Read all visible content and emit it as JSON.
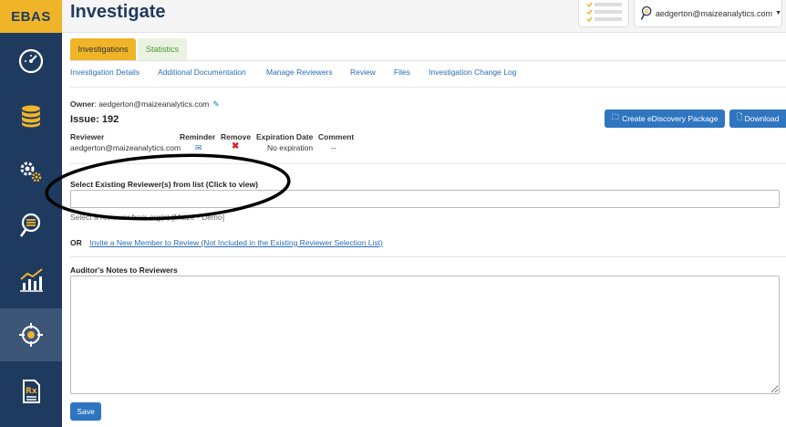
{
  "brand": "EBAS",
  "header": {
    "title": "Investigate",
    "user": "aedgerton@maizeanalytics.com"
  },
  "sidebar": {
    "items": [
      {
        "icon": "gauge-icon"
      },
      {
        "icon": "database-icon"
      },
      {
        "icon": "gears-icon"
      },
      {
        "icon": "investigate-icon"
      },
      {
        "icon": "chart-icon"
      },
      {
        "icon": "target-icon",
        "active": true
      },
      {
        "icon": "prescription-icon"
      }
    ]
  },
  "tabs": [
    "Investigations",
    "Statistics"
  ],
  "subnav": [
    "Investigation Details",
    "Additional Documentation",
    "Manage Reviewers",
    "Review",
    "Files",
    "Investigation Change Log"
  ],
  "owner": {
    "label": "Owner",
    "value": "aedgerton@maizeanalytics.com"
  },
  "issue": "Issue: 192",
  "buttons": {
    "ediscovery": "Create eDiscovery Package",
    "download": "Download",
    "save": "Save"
  },
  "reviewer_table": {
    "headers": [
      "Reviewer",
      "Reminder",
      "Remove",
      "Expiration Date",
      "Comment"
    ],
    "rows": [
      {
        "reviewer": "aedgerton@maizeanalytics.com",
        "expiration": "No expiration",
        "comment": "--"
      }
    ]
  },
  "select_reviewers": {
    "label": "Select Existing Reviewer(s) from list (Click to view)",
    "value": "",
    "help": "Select a reviewer from org(s) [Maize - Demo]"
  },
  "invite": {
    "or": "OR",
    "link": "Invite a New Member to Review (Not Included in the Existing Reviewer Selection List)"
  },
  "notes": {
    "label": "Auditor's Notes to Reviewers",
    "value": ""
  },
  "colors": {
    "sidebar": "#1f3a5f",
    "brand": "#f0b429",
    "primary": "#2f75c0",
    "link": "#2a6db5",
    "danger": "#d9232d"
  }
}
